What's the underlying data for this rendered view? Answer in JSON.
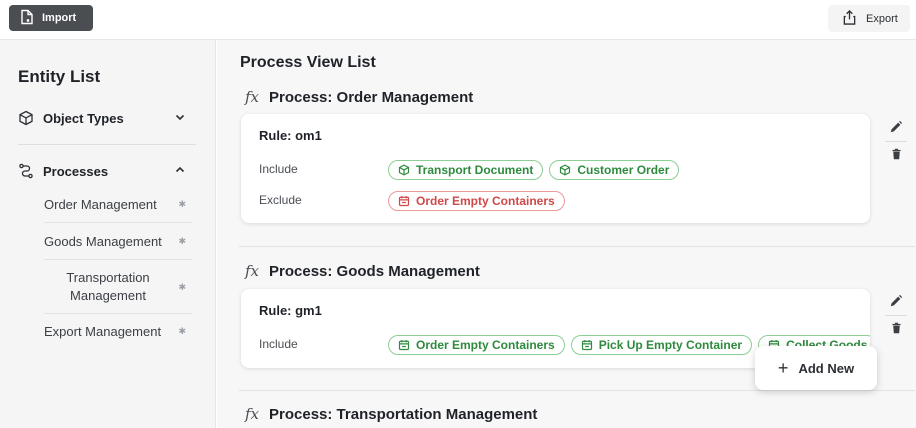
{
  "toolbar": {
    "import_label": "Import",
    "export_label": "Export"
  },
  "sidebar": {
    "title": "Entity List",
    "object_types_label": "Object Types",
    "processes_label": "Processes",
    "processes": [
      {
        "label": "Order Management"
      },
      {
        "label": "Goods Management"
      },
      {
        "label": "Transportation Management"
      },
      {
        "label": "Export Management"
      }
    ],
    "dot": "✱"
  },
  "main": {
    "title": "Process View List",
    "fx_symbol": "fx",
    "processes": [
      {
        "title": "Process: Order Management",
        "rule": "Rule: om1",
        "include_label": "Include",
        "include": [
          {
            "label": "Transport Document",
            "icon": "cube-icon"
          },
          {
            "label": "Customer Order",
            "icon": "cube-icon"
          }
        ],
        "exclude_label": "Exclude",
        "exclude": [
          {
            "label": "Order Empty Containers",
            "icon": "calendar-icon"
          }
        ]
      },
      {
        "title": "Process: Goods Management",
        "rule": "Rule: gm1",
        "include_label": "Include",
        "include": [
          {
            "label": "Order Empty Containers",
            "icon": "calendar-icon"
          },
          {
            "label": "Pick Up Empty Container",
            "icon": "calendar-icon"
          },
          {
            "label": "Collect Goods",
            "icon": "calendar-icon"
          }
        ]
      },
      {
        "title": "Process: Transportation Management"
      }
    ],
    "add_new_label": "Add New"
  },
  "colors": {
    "accent_green": "#2e8b3e",
    "accent_red": "#d04848",
    "import_bg": "#4a4d52"
  }
}
